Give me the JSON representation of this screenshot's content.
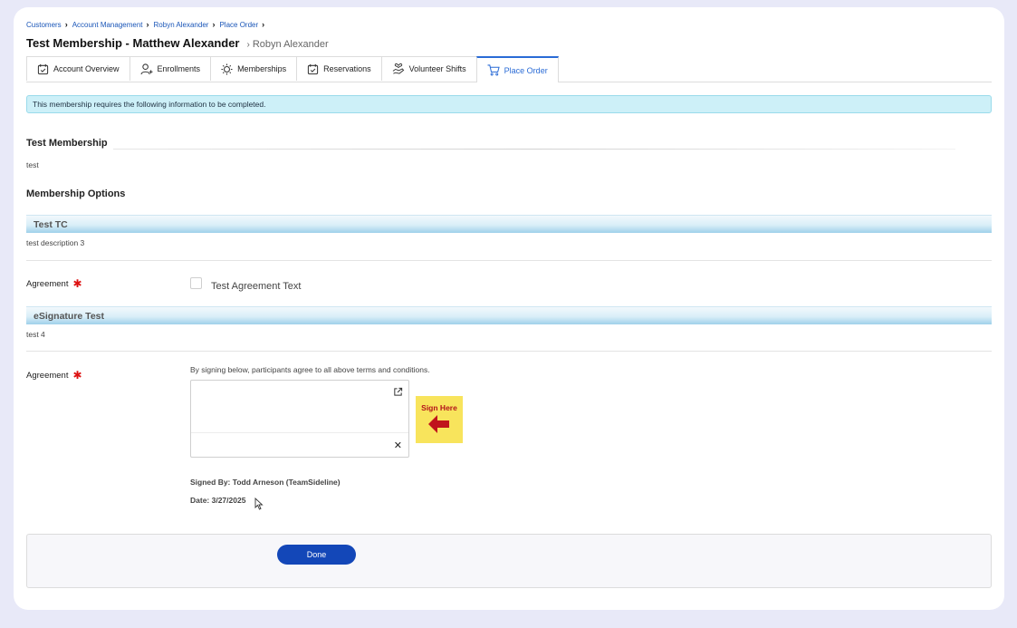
{
  "breadcrumb": [
    {
      "label": "Customers"
    },
    {
      "label": "Account Management"
    },
    {
      "label": "Robyn Alexander"
    },
    {
      "label": "Place Order"
    }
  ],
  "header": {
    "title": "Test Membership - Matthew Alexander",
    "subtitle": "Robyn Alexander"
  },
  "tabs": [
    {
      "label": "Account Overview",
      "icon": "calendar-check-icon"
    },
    {
      "label": "Enrollments",
      "icon": "user-plus-icon"
    },
    {
      "label": "Memberships",
      "icon": "sun-badge-icon"
    },
    {
      "label": "Reservations",
      "icon": "calendar-check-icon"
    },
    {
      "label": "Volunteer Shifts",
      "icon": "hand-heart-icon"
    },
    {
      "label": "Place Order",
      "icon": "cart-icon",
      "active": true
    }
  ],
  "info_banner": "This membership requires the following information to be completed.",
  "membership": {
    "title": "Test Membership",
    "description": "test"
  },
  "options_heading": "Membership Options",
  "options": [
    {
      "name": "Test TC",
      "description": "test description 3",
      "field_label": "Agreement",
      "checkbox_text": "Test Agreement Text"
    },
    {
      "name": "eSignature Test",
      "description": "test 4",
      "field_label": "Agreement",
      "instruction": "By signing below, participants agree to all above terms and conditions.",
      "sign_here": "Sign Here",
      "clear_symbol": "✕",
      "signed_by": "Signed By: Todd Arneson (TeamSideline)",
      "date": "Date: 3/27/2025"
    }
  ],
  "footer": {
    "done_label": "Done"
  },
  "colors": {
    "accent": "#2a6bd6",
    "primary_button": "#1347b8",
    "info_bg": "#cdf0f8",
    "required": "#dd1111",
    "sign_here_bg": "#f8e45c"
  }
}
